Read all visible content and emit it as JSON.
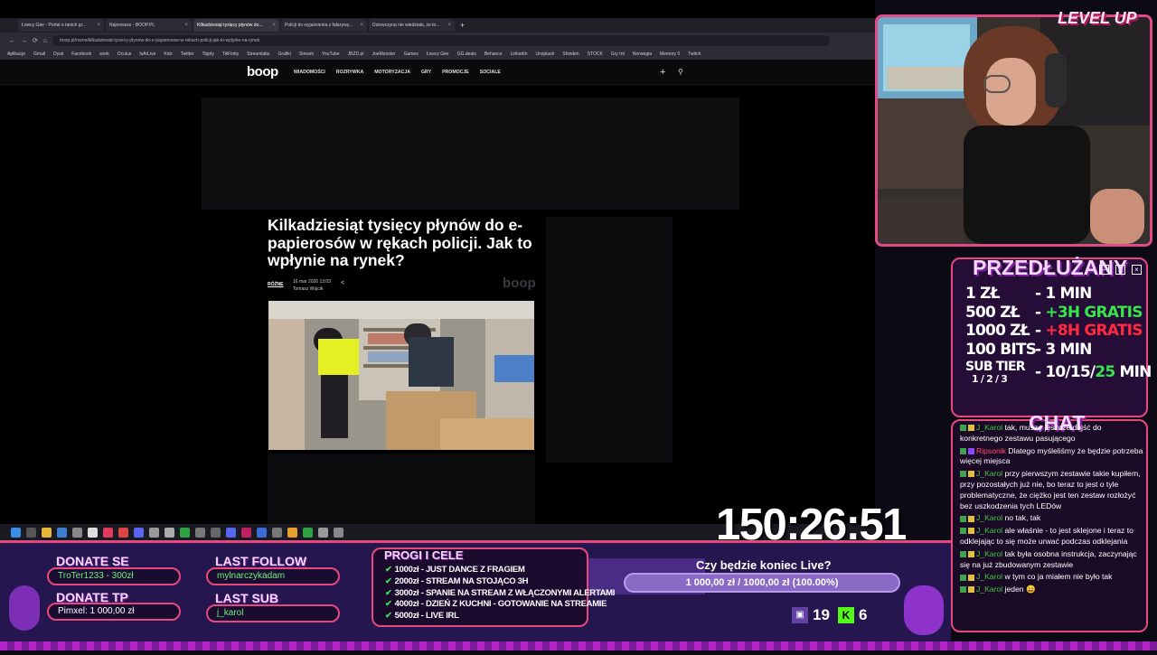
{
  "browser": {
    "tabs": [
      {
        "label": "Łowcy Gier - Portal o tanich gr...",
        "active": false
      },
      {
        "label": "Najnowsze - BOOP.PL",
        "active": false
      },
      {
        "label": "Kilkadziesiąt tysięcy płynów do...",
        "active": true
      },
      {
        "label": "Policji do wyjaśnienia z fałszywy...",
        "active": false
      },
      {
        "label": "Dziewczyna nie wiedziała, że to...",
        "active": false
      }
    ],
    "url": "boop.pl/rozne/kilkadziesiat-tysiecy-plynow-do-e-papierosow-w-rekach-policji-jak-to-wplynie-na-rynek",
    "bookmarks": [
      "Aplikacje",
      "Gmail",
      "Dysk",
      "Facebook",
      "work",
      "Oculus",
      "IsArLive",
      "Kick",
      "Twitter",
      "Tipply",
      "TikFinity",
      "Streamlabs",
      "Grafiki",
      "Stream",
      "YouTube",
      "JBZD.pl",
      "JoeMonster",
      "Games",
      "Łowcy Gier",
      "GG.deals",
      "Behance",
      "LinkedIn",
      "Unsplash",
      "Shinden",
      "STOCK",
      "Gry tnt",
      "Norwegia",
      "Memory 5",
      "Twitch"
    ]
  },
  "site": {
    "logo": "boop",
    "nav": [
      "WIADOMOŚCI",
      "ROZRYWKA",
      "MOTORYZACJA",
      "GRY",
      "PROMOCJE",
      "SOCIALE"
    ],
    "headline": "Kilkadziesiąt tysięcy płynów do e-papierosów w rękach policji. Jak to wpłynie na rynek?",
    "category": "RÓŻNE",
    "date": "16 mar 2026 13:03",
    "author": "Tomasz Wójcik",
    "watermark": "boop"
  },
  "overlay": {
    "logo": "LEVEL UP",
    "prices_title": "PRZEDŁUŻANY",
    "prices": [
      {
        "a": "1 ZŁ",
        "b": "1 MIN",
        "cls": ""
      },
      {
        "a": "500 ZŁ",
        "b": "+3H GRATIS",
        "cls": "green"
      },
      {
        "a": "1000 ZŁ",
        "b": "+8H GRATIS",
        "cls": "red"
      },
      {
        "a": "100 BITS",
        "b": "3 MIN",
        "cls": ""
      }
    ],
    "sub_label": "SUB TIER",
    "sub_tiers": "1 / 2 / 3",
    "sub_value": "10/15/",
    "sub_value_hl": "25",
    "sub_unit": " MIN",
    "chat_title": "CHAT",
    "chat": [
      {
        "user": "J_Karol",
        "text": "tak, muszę jeszcze dojść do konkretnego zestawu pasującego",
        "color": "un-g"
      },
      {
        "user": "Ripsonik",
        "text": "Dlatego myśleliśmy że będzie potrzeba więcej miejsca",
        "color": "un-r"
      },
      {
        "user": "J_Karol",
        "text": "przy pierwszym zestawie takie kupiłem, przy pozostałych już nie, bo teraz to jest o tyle problematyczne, że ciężko jest ten zestaw rozłożyć bez uszkodzenia tych LEDów",
        "color": "un-g"
      },
      {
        "user": "J_Karol",
        "text": "no tak, tak",
        "color": "un-g"
      },
      {
        "user": "J_Karol",
        "text": "ale właśnie - to jest sklejone i teraz to odklejając to się może urwać podczas odklejania",
        "color": "un-g"
      },
      {
        "user": "J_Karol",
        "text": "tak była osobna instrukcja, zaczynając się na już zbudowanym zestawie",
        "color": "un-g"
      },
      {
        "user": "J_Karol",
        "text": "w tym co ja miałem nie było tak",
        "color": "un-g"
      },
      {
        "user": "J_Karol",
        "text": "jeden 😄",
        "color": "un-g"
      }
    ],
    "timer": "150:26:51",
    "donate_se_label": "DONATE SE",
    "donate_se_value": "TroTer1233 - 300zł",
    "donate_tp_label": "DONATE TP",
    "donate_tp_value": "Pimxel: 1 000,00 zł",
    "last_follow_label": "LAST FOLLOW",
    "last_follow_value": "mylnarczykadam",
    "last_sub_label": "LAST SUB",
    "last_sub_value": "j_karol",
    "goals_title": "PROGI I CELE",
    "goals": [
      "1000zł - JUST DANCE Z FRAGIEM",
      "2000zł - STREAM NA STOJĄCO 3H",
      "3000zł - SPANIE NA STREAM Z WŁĄCZONYMI ALERTAMI",
      "4000zł - DZIEŃ Z KUCHNI - GOTOWANIE NA STREAMIE",
      "5000zł - LIVE IRL"
    ],
    "poll_question": "Czy będzie koniec Live?",
    "poll_value": "1 000,00 zł / 1000,00 zł (100.00%)",
    "poll_fraction": 1.0,
    "twitch_viewers": "19",
    "kick_viewers": "6"
  }
}
